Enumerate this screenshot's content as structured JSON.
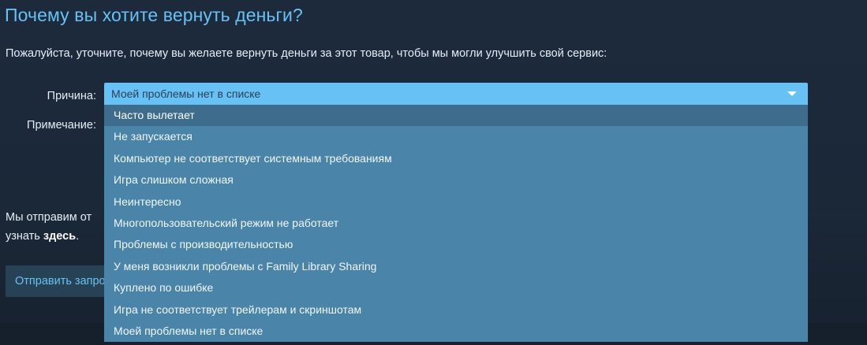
{
  "page": {
    "title": "Почему вы хотите вернуть деньги?",
    "subtitle": "Пожалуйста, уточните, почему вы желаете вернуть деньги за этот товар, чтобы мы могли улучшить свой сервис:",
    "reason_label": "Причина:",
    "note_label": "Примечание:",
    "info_line1_partial": "Мы отправим от",
    "info_line2_prefix": "узнать ",
    "info_line2_link": "здесь",
    "info_line2_suffix": ".",
    "submit_label": "Отправить запрос"
  },
  "dropdown": {
    "selected": "Моей проблемы нет в списке",
    "options": [
      "Часто вылетает",
      "Не запускается",
      "Компьютер не соответствует системным требованиям",
      "Игра слишком сложная",
      "Неинтересно",
      "Многопользовательский режим не работает",
      "Проблемы с производительностью",
      "У меня возникли проблемы с Family Library Sharing",
      "Куплено по ошибке",
      "Игра не соответствует трейлерам и скриншотам",
      "Моей проблемы нет в списке"
    ],
    "highlighted_index": 0
  },
  "colors": {
    "accent": "#67c1f5",
    "background": "#1b2838",
    "dropdown_list": "#4a84a8",
    "dropdown_highlight": "#3d6c8c"
  },
  "icons": {
    "dropdown_caret": "chevron-down-icon"
  }
}
